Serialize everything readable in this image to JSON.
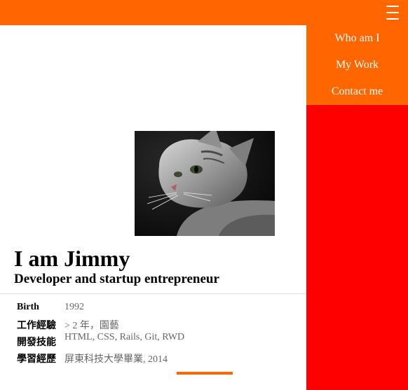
{
  "nav": {
    "menu_items": [
      {
        "label": "Who am I"
      },
      {
        "label": "My Work"
      },
      {
        "label": "Contact me"
      }
    ]
  },
  "profile": {
    "name": "I am Jimmy",
    "tagline": "Developer and startup entrepreneur",
    "photo": "cat-photo"
  },
  "info": [
    {
      "label": "Birth",
      "value": "1992"
    },
    {
      "label": "工作經驗",
      "value": "> 2 年，園藝"
    },
    {
      "label": "開發技能",
      "value": "HTML, CSS, Rails, Git, RWD"
    },
    {
      "label": "學習經歷",
      "value": "屏東科技大學畢業, 2014"
    }
  ],
  "colors": {
    "accent": "#ff6600",
    "panel": "#ff0000",
    "text": "#000000",
    "muted": "#666666"
  }
}
